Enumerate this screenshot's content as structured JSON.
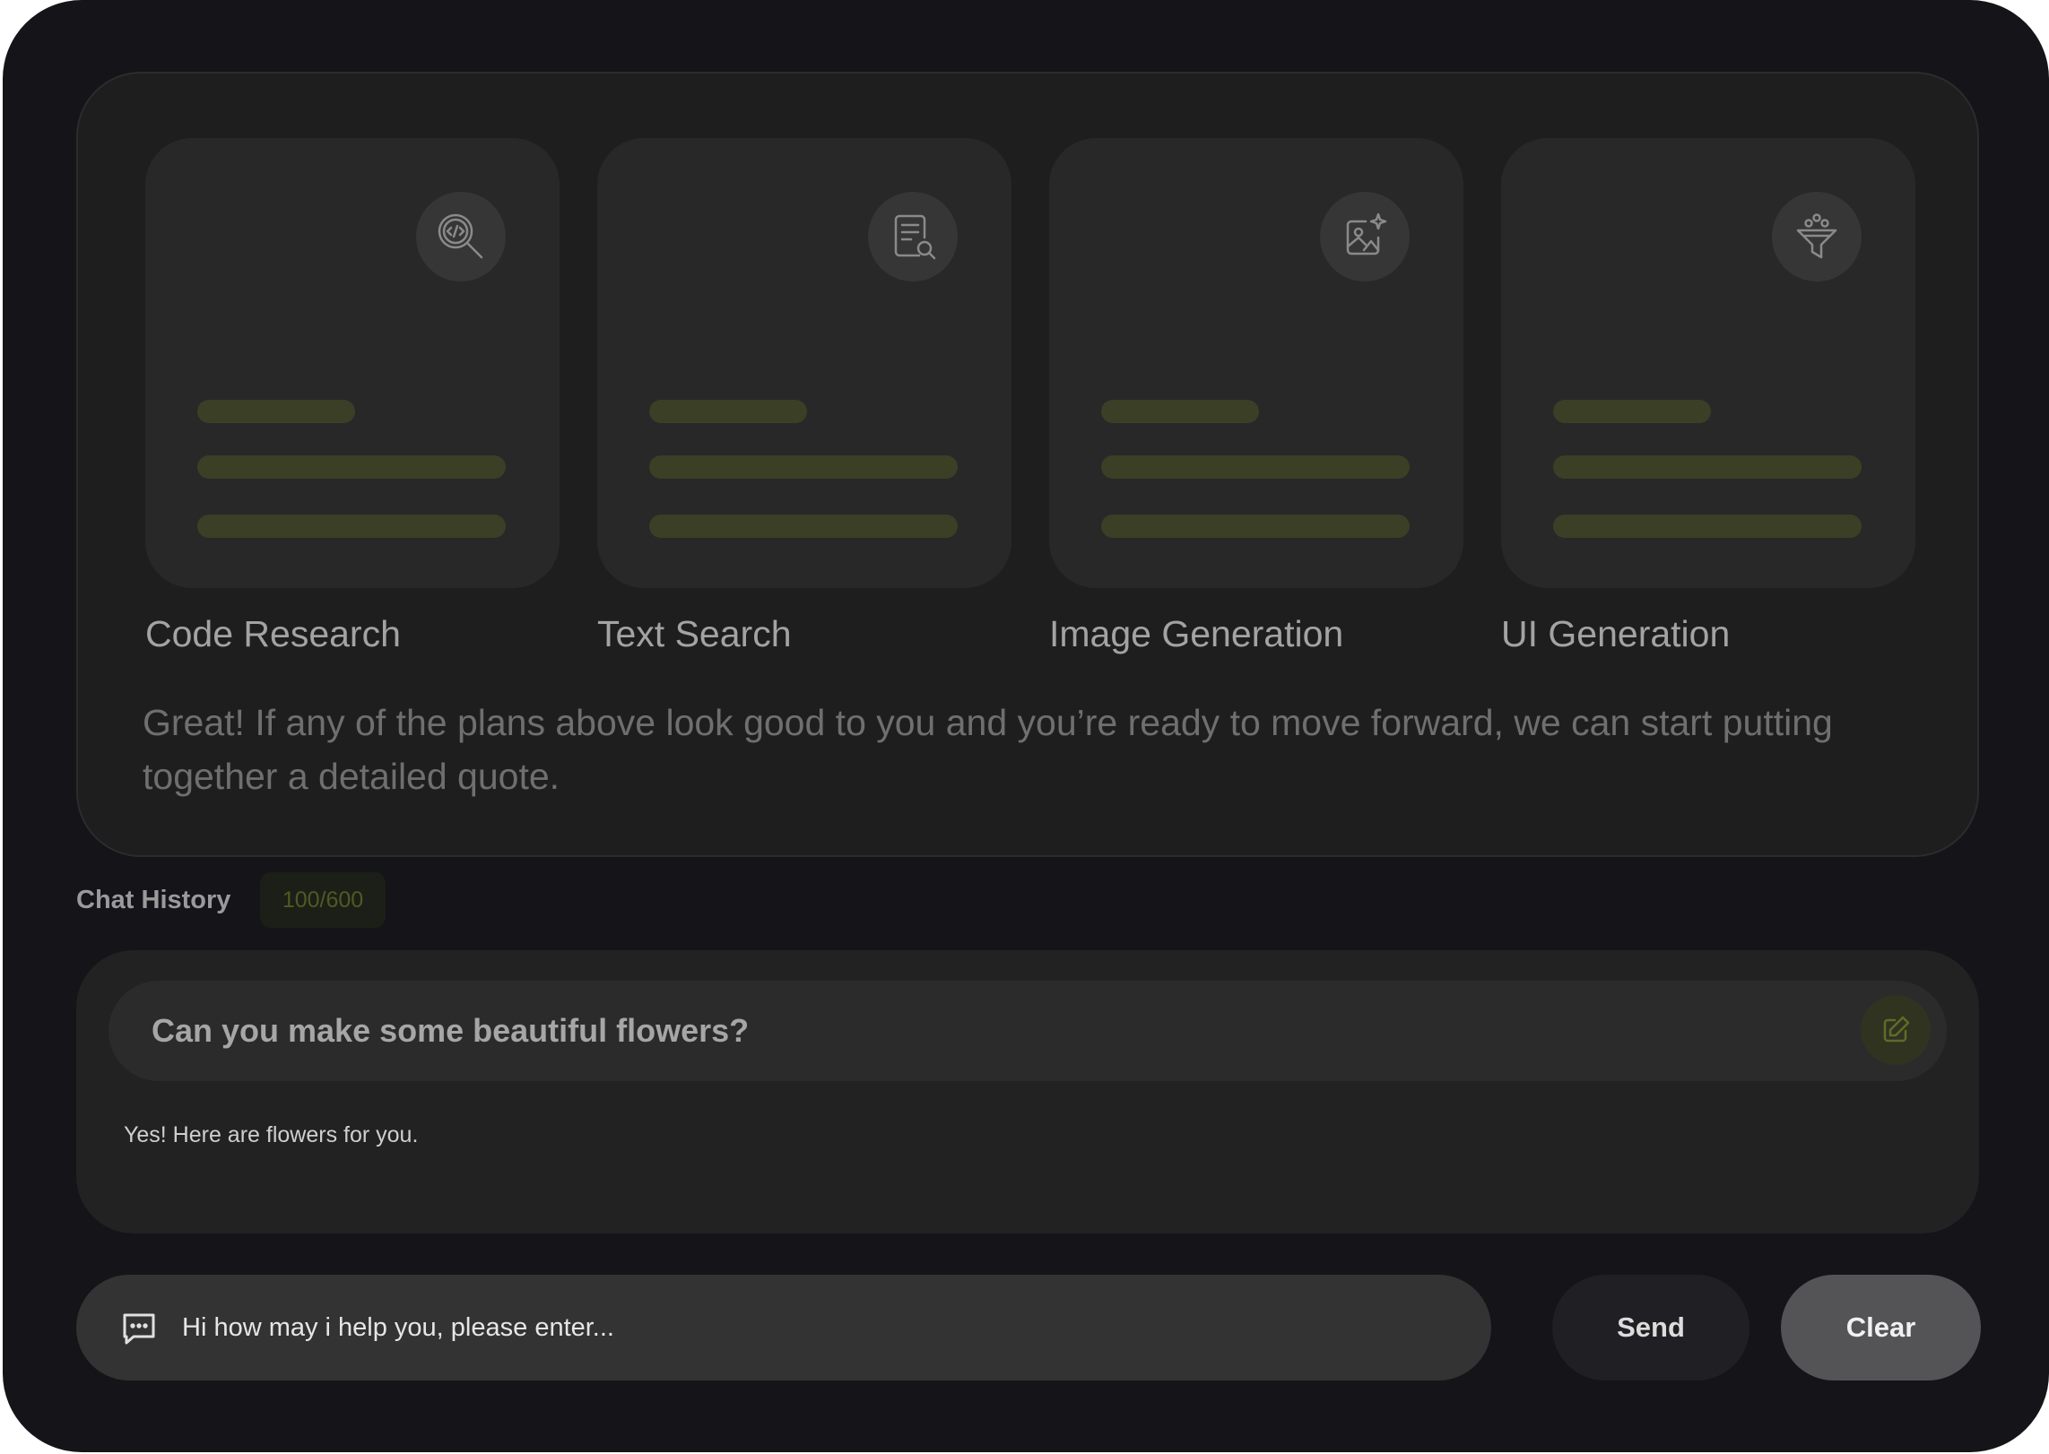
{
  "cards": [
    {
      "title": "Code Research",
      "icon": "code-search-icon"
    },
    {
      "title": "Text Search",
      "icon": "document-search-icon"
    },
    {
      "title": "Image Generation",
      "icon": "image-sparkle-icon"
    },
    {
      "title": "UI Generation",
      "icon": "filter-funnel-icon"
    }
  ],
  "description": "Great! If any of the plans above look good to you and you’re ready to move forward, we can start putting together a detailed quote.",
  "chat_history": {
    "label": "Chat History",
    "count": "100/600"
  },
  "conversation": {
    "question": "Can you make some beautiful flowers?",
    "answer": "Yes! Here are flowers for you."
  },
  "input": {
    "placeholder": "Hi how may i help you, please enter..."
  },
  "buttons": {
    "send": "Send",
    "clear": "Clear"
  },
  "colors": {
    "background": "#141419",
    "panel": "#1e1e1e",
    "card": "#282828",
    "accent_bar": "#3b3f26",
    "badge_text": "#4e5a24"
  }
}
